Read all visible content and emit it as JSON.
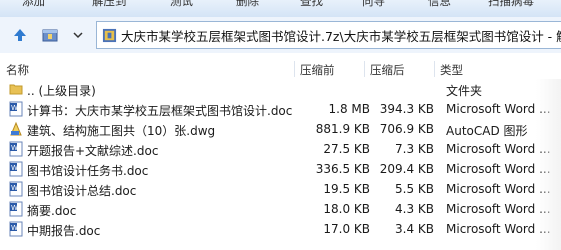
{
  "toolbar": {
    "items": [
      "添加",
      "解压到",
      "测试",
      "删除",
      "查找",
      "向导",
      "信息",
      "扫描病毒"
    ]
  },
  "address": {
    "path": "大庆市某学校五层框架式图书馆设计.7z\\大庆市某学校五层框架式图书馆设计 - 解"
  },
  "columns": {
    "name": "名称",
    "compressed": "压缩前",
    "original": "压缩后",
    "type": "类型"
  },
  "files": [
    {
      "name": ".. (上级目录)",
      "csize": "",
      "osize": "",
      "type": "文件夹",
      "icon": "folder-icon"
    },
    {
      "name": "计算书：大庆市某学校五层框架式图书馆设计.doc",
      "csize": "1.8 MB",
      "osize": "394.3 KB",
      "type": "Microsoft Word ...",
      "icon": "word-doc-icon"
    },
    {
      "name": "建筑、结构施工图共（10）张.dwg",
      "csize": "881.9 KB",
      "osize": "706.9 KB",
      "type": "AutoCAD 图形",
      "icon": "dwg-icon"
    },
    {
      "name": "开题报告+文献综述.doc",
      "csize": "27.5 KB",
      "osize": "7.3 KB",
      "type": "Microsoft Word ...",
      "icon": "word-doc-icon"
    },
    {
      "name": "图书馆设计任务书.doc",
      "csize": "336.5 KB",
      "osize": "209.4 KB",
      "type": "Microsoft Word ...",
      "icon": "word-doc-icon"
    },
    {
      "name": "图书馆设计总结.doc",
      "csize": "19.5 KB",
      "osize": "5.5 KB",
      "type": "Microsoft Word ...",
      "icon": "word-doc-icon"
    },
    {
      "name": "摘要.doc",
      "csize": "18.0 KB",
      "osize": "4.3 KB",
      "type": "Microsoft Word ...",
      "icon": "word-doc-icon"
    },
    {
      "name": "中期报告.doc",
      "csize": "17.0 KB",
      "osize": "3.4 KB",
      "type": "Microsoft Word ...",
      "icon": "word-doc-icon"
    }
  ]
}
